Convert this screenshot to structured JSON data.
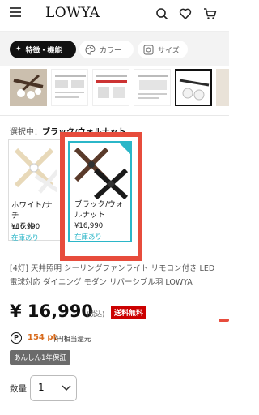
{
  "header": {
    "logo": "LOWYA",
    "icons": [
      "menu-icon",
      "search-icon",
      "heart-icon",
      "cart-icon"
    ]
  },
  "chips": [
    {
      "label": "特徴・機能",
      "icon": "sparkle-icon",
      "active": true
    },
    {
      "label": "カラー",
      "icon": "palette-icon",
      "active": false
    },
    {
      "label": "サイズ",
      "icon": "size-icon",
      "active": false
    }
  ],
  "selection": {
    "label": "選択中：",
    "value": "ブラック/ウォルナット"
  },
  "variants": [
    {
      "name_line1": "ホワイト/ナチ",
      "name_line2": "ュラル",
      "price": "¥16,990",
      "stock": "在庫あり",
      "selected": false
    },
    {
      "name_line1": "ブラック/ウォ",
      "name_line2": "ルナット",
      "price": "¥16,990",
      "stock": "在庫あり",
      "selected": true
    }
  ],
  "product": {
    "title": "[4灯] 天井照明 シーリングファンライト リモコン付き LED電球対応 ダイニング モダン リバーシブル羽 LOWYA",
    "price": "¥ 16,990",
    "tax_note": "(税込)",
    "shipping": "送料無料",
    "points_icon": "P",
    "points": "154 pt",
    "points_note": "/円相当還元",
    "badge": "あんしん1年保証"
  },
  "quantity": {
    "label": "数量",
    "value": "1"
  },
  "colors": {
    "accent": "#2bb6c8",
    "highlight_box": "#e74c3c",
    "shipping_bg": "#cc0000",
    "points": "#d86b1d"
  }
}
